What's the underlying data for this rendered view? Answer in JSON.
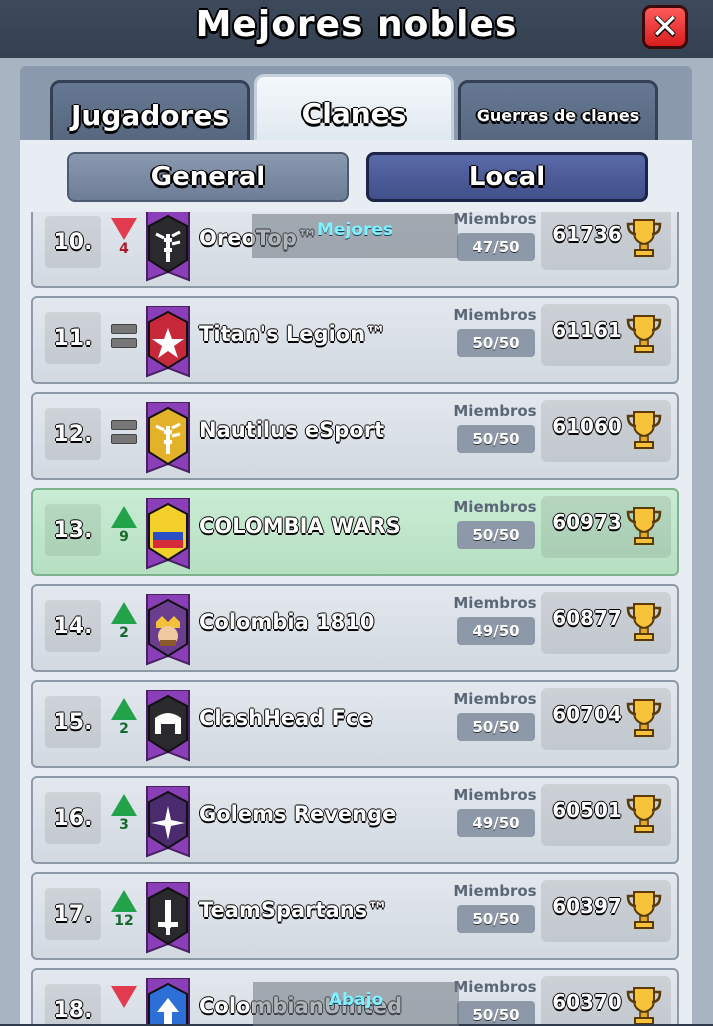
{
  "header": {
    "title": "Mejores nobles"
  },
  "tabs": [
    {
      "label": "Jugadores"
    },
    {
      "label": "Clanes"
    },
    {
      "label": "Guerras de clanes"
    }
  ],
  "subtabs": [
    {
      "label": "General"
    },
    {
      "label": "Local"
    }
  ],
  "overlay": {
    "top_label": "Mejores",
    "bottom_label": "Abajo"
  },
  "rows": [
    {
      "rank": "10.",
      "trend": "down",
      "trend_value": "4",
      "name": "OreoTop™",
      "members_label": "Miembros",
      "members": "47/50",
      "score": "61736",
      "highlight": false,
      "badge_color": "#2a2a2e",
      "badge_icon": "bamboo-icon"
    },
    {
      "rank": "11.",
      "trend": "same",
      "trend_value": "",
      "name": "Titan's Legion™",
      "members_label": "Miembros",
      "members": "50/50",
      "score": "61161",
      "highlight": false,
      "badge_color": "#c7283a",
      "badge_icon": "star-icon"
    },
    {
      "rank": "12.",
      "trend": "same",
      "trend_value": "",
      "name": "Nautilus eSport",
      "members_label": "Miembros",
      "members": "50/50",
      "score": "61060",
      "highlight": false,
      "badge_color": "#e3b22a",
      "badge_icon": "bamboo-icon"
    },
    {
      "rank": "13.",
      "trend": "up",
      "trend_value": "9",
      "name": "COLOMBIA WARS",
      "members_label": "Miembros",
      "members": "50/50",
      "score": "60973",
      "highlight": true,
      "badge_color": "#f3cf2a",
      "badge_icon": "flag-icon"
    },
    {
      "rank": "14.",
      "trend": "up",
      "trend_value": "2",
      "name": "Colombia 1810",
      "members_label": "Miembros",
      "members": "49/50",
      "score": "60877",
      "highlight": false,
      "badge_color": "#6b3d8f",
      "badge_icon": "king-icon"
    },
    {
      "rank": "15.",
      "trend": "up",
      "trend_value": "2",
      "name": "ClashHead Fce",
      "members_label": "Miembros",
      "members": "50/50",
      "score": "60704",
      "highlight": false,
      "badge_color": "#2a2a2e",
      "badge_icon": "helmet-icon"
    },
    {
      "rank": "16.",
      "trend": "up",
      "trend_value": "3",
      "name": "Golems Revenge",
      "members_label": "Miembros",
      "members": "49/50",
      "score": "60501",
      "highlight": false,
      "badge_color": "#4a2c6e",
      "badge_icon": "burst-icon"
    },
    {
      "rank": "17.",
      "trend": "up",
      "trend_value": "12",
      "name": "TeamSpartans™",
      "members_label": "Miembros",
      "members": "50/50",
      "score": "60397",
      "highlight": false,
      "badge_color": "#2a2a2e",
      "badge_icon": "sword-icon"
    },
    {
      "rank": "18.",
      "trend": "down",
      "trend_value": "",
      "name": "ColombianUnited",
      "members_label": "Miembros",
      "members": "50/50",
      "score": "60370",
      "highlight": false,
      "badge_color": "#2c6fd6",
      "badge_icon": "arrow-up-icon"
    }
  ]
}
